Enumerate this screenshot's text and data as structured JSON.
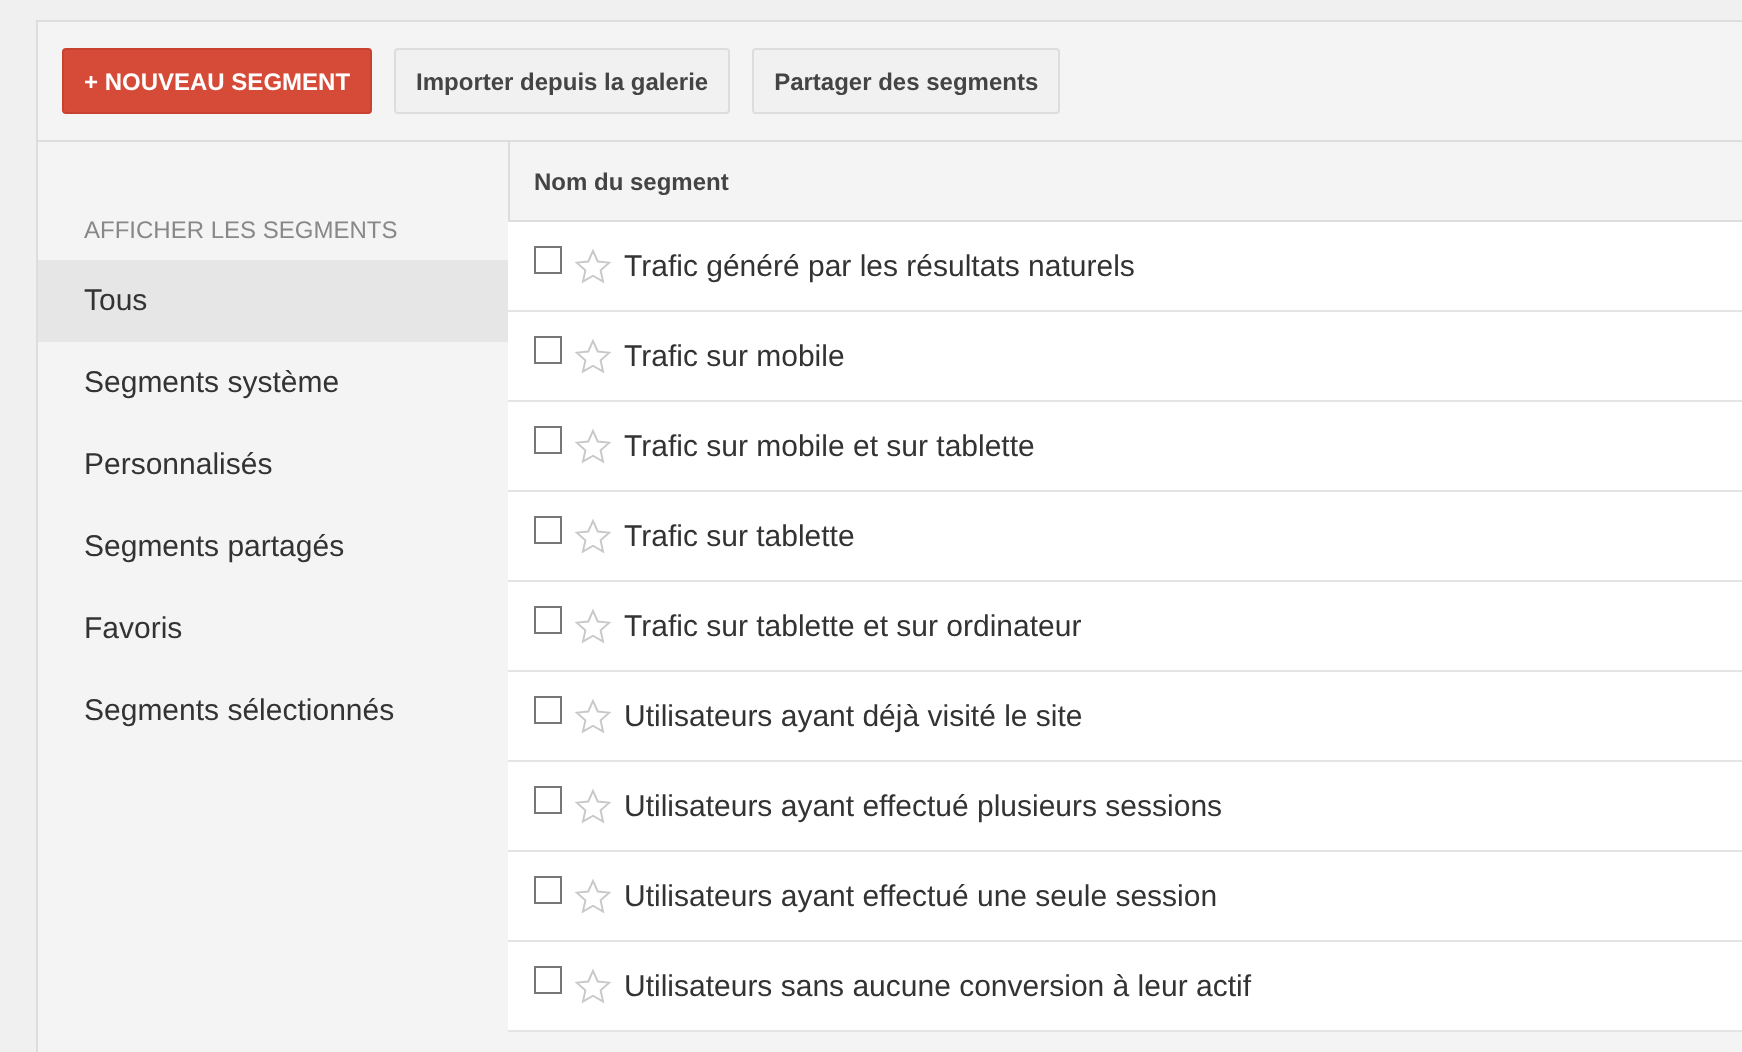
{
  "toolbar": {
    "buttons": [
      {
        "label": "+ NOUVEAU SEGMENT",
        "kind": "primary"
      },
      {
        "label": "Importer depuis la galerie",
        "kind": "secondary"
      },
      {
        "label": "Partager des segments",
        "kind": "secondary"
      }
    ]
  },
  "sidebar": {
    "heading": "AFFICHER LES SEGMENTS",
    "items": [
      {
        "label": "Tous",
        "selected": true
      },
      {
        "label": "Segments système",
        "selected": false
      },
      {
        "label": "Personnalisés",
        "selected": false
      },
      {
        "label": "Segments partagés",
        "selected": false
      },
      {
        "label": "Favoris",
        "selected": false
      },
      {
        "label": "Segments sélectionnés",
        "selected": false
      }
    ]
  },
  "table": {
    "columns": [
      "Nom du segment"
    ],
    "rows": [
      {
        "name": "Trafic généré par les résultats naturels",
        "checked": false,
        "starred": false
      },
      {
        "name": "Trafic sur mobile",
        "checked": false,
        "starred": false
      },
      {
        "name": "Trafic sur mobile et sur tablette",
        "checked": false,
        "starred": false
      },
      {
        "name": "Trafic sur tablette",
        "checked": false,
        "starred": false
      },
      {
        "name": "Trafic sur tablette et sur ordinateur",
        "checked": false,
        "starred": false
      },
      {
        "name": "Utilisateurs ayant déjà visité le site",
        "checked": false,
        "starred": false
      },
      {
        "name": "Utilisateurs ayant effectué plusieurs sessions",
        "checked": false,
        "starred": false
      },
      {
        "name": "Utilisateurs ayant effectué une seule session",
        "checked": false,
        "starred": false
      },
      {
        "name": "Utilisateurs sans aucune conversion à leur actif",
        "checked": false,
        "starred": false
      }
    ]
  }
}
